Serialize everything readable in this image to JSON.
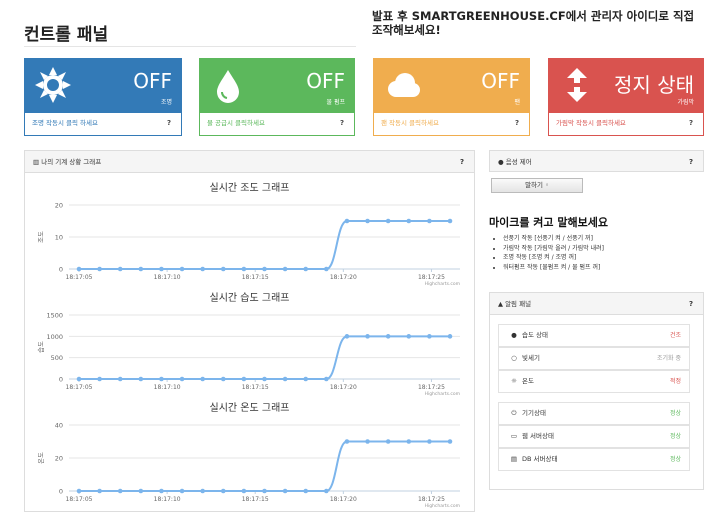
{
  "header": {
    "title": "컨트롤 패널",
    "notice": "발표 후 SMARTGREENHOUSE.CF에서 관리자 아이디로 직접 조작해보세요!"
  },
  "cards": [
    {
      "icon": "sun-icon",
      "state": "OFF",
      "label": "조명",
      "footer": "조명 작동시 클릭 하세요",
      "help": "?",
      "color": "#337ab7"
    },
    {
      "icon": "water-drop-icon",
      "state": "OFF",
      "label": "물 펌프",
      "footer": "물 공급시 클릭하세요",
      "help": "?",
      "color": "#5cb85c"
    },
    {
      "icon": "cloud-icon",
      "state": "OFF",
      "label": "팬",
      "footer": "팬 작동시 클릭하세요",
      "help": "?",
      "color": "#f0ad4e"
    },
    {
      "icon": "up-down-arrows-icon",
      "state": "정지 상태",
      "label": "가림막",
      "footer": "가림막 작동시 클릭하세요",
      "help": "?",
      "color": "#d9534f"
    }
  ],
  "chart_panel": {
    "title": "나의 기계 상황 그래프",
    "help": "?"
  },
  "chart_data": [
    {
      "type": "line",
      "title": "실시간 조도 그래프",
      "ylabel": "조도",
      "ylim": [
        0,
        20
      ],
      "yticks": [
        "0",
        "10",
        "20"
      ],
      "xticks": [
        "18:17:05",
        "18:17:10",
        "18:17:15",
        "18:17:20",
        "18:17:25"
      ],
      "credits": "Highcharts.com",
      "series": [
        {
          "values": [
            0,
            0,
            0,
            0,
            0,
            0,
            0,
            0,
            0,
            0,
            0,
            0,
            0,
            15,
            15,
            15,
            15,
            15,
            15
          ]
        }
      ]
    },
    {
      "type": "line",
      "title": "실시간 습도 그래프",
      "ylabel": "습도",
      "ylim": [
        0,
        1500
      ],
      "yticks": [
        "0",
        "500",
        "1000",
        "1500"
      ],
      "xticks": [
        "18:17:05",
        "18:17:10",
        "18:17:15",
        "18:17:20",
        "18:17:25"
      ],
      "credits": "Highcharts.com",
      "series": [
        {
          "values": [
            0,
            0,
            0,
            0,
            0,
            0,
            0,
            0,
            0,
            0,
            0,
            0,
            0,
            1000,
            1000,
            1000,
            1000,
            1000,
            1000
          ]
        }
      ]
    },
    {
      "type": "line",
      "title": "실시간 온도 그래프",
      "ylabel": "온도",
      "ylim": [
        0,
        40
      ],
      "yticks": [
        "0",
        "20",
        "40"
      ],
      "xticks": [
        "18:17:05",
        "18:17:10",
        "18:17:15",
        "18:17:20",
        "18:17:25"
      ],
      "credits": "Highcharts.com",
      "series": [
        {
          "values": [
            0,
            0,
            0,
            0,
            0,
            0,
            0,
            0,
            0,
            0,
            0,
            0,
            0,
            30,
            30,
            30,
            30,
            30,
            30
          ]
        }
      ]
    }
  ],
  "voice": {
    "title": "음성 제어",
    "help": "?",
    "button": "말하기",
    "heading": "마이크를 켜고 말해보세요",
    "commands": [
      "선풍기 작동 [선풍기 켜 / 선풍기 꺼]",
      "가림막 작동 [가림막 올려 / 가림막 내려]",
      "조명 작동 [조명 켜 / 조명 꺼]",
      "워터펌프 작동 [물펌프 켜 / 물 펌프 꺼]"
    ]
  },
  "alerts": {
    "title": "알림 패널",
    "help": "?",
    "items": [
      {
        "icon": "water-drop-icon",
        "label": "습도 상태",
        "value": "건조",
        "color": "#d9534f"
      },
      {
        "icon": "circle-icon",
        "label": "빛세기",
        "value": "조기화 중",
        "color": "#999999"
      },
      {
        "icon": "sun-icon",
        "label": "온도",
        "value": "적정",
        "color": "#d9534f"
      },
      {
        "icon": "power-icon",
        "label": "기기상태",
        "value": "정상",
        "color": "#5cb85c"
      },
      {
        "icon": "monitor-icon",
        "label": "웹 서버상태",
        "value": "정상",
        "color": "#5cb85c"
      },
      {
        "icon": "database-icon",
        "label": "DB 서버상태",
        "value": "정상",
        "color": "#5cb85c"
      }
    ]
  }
}
